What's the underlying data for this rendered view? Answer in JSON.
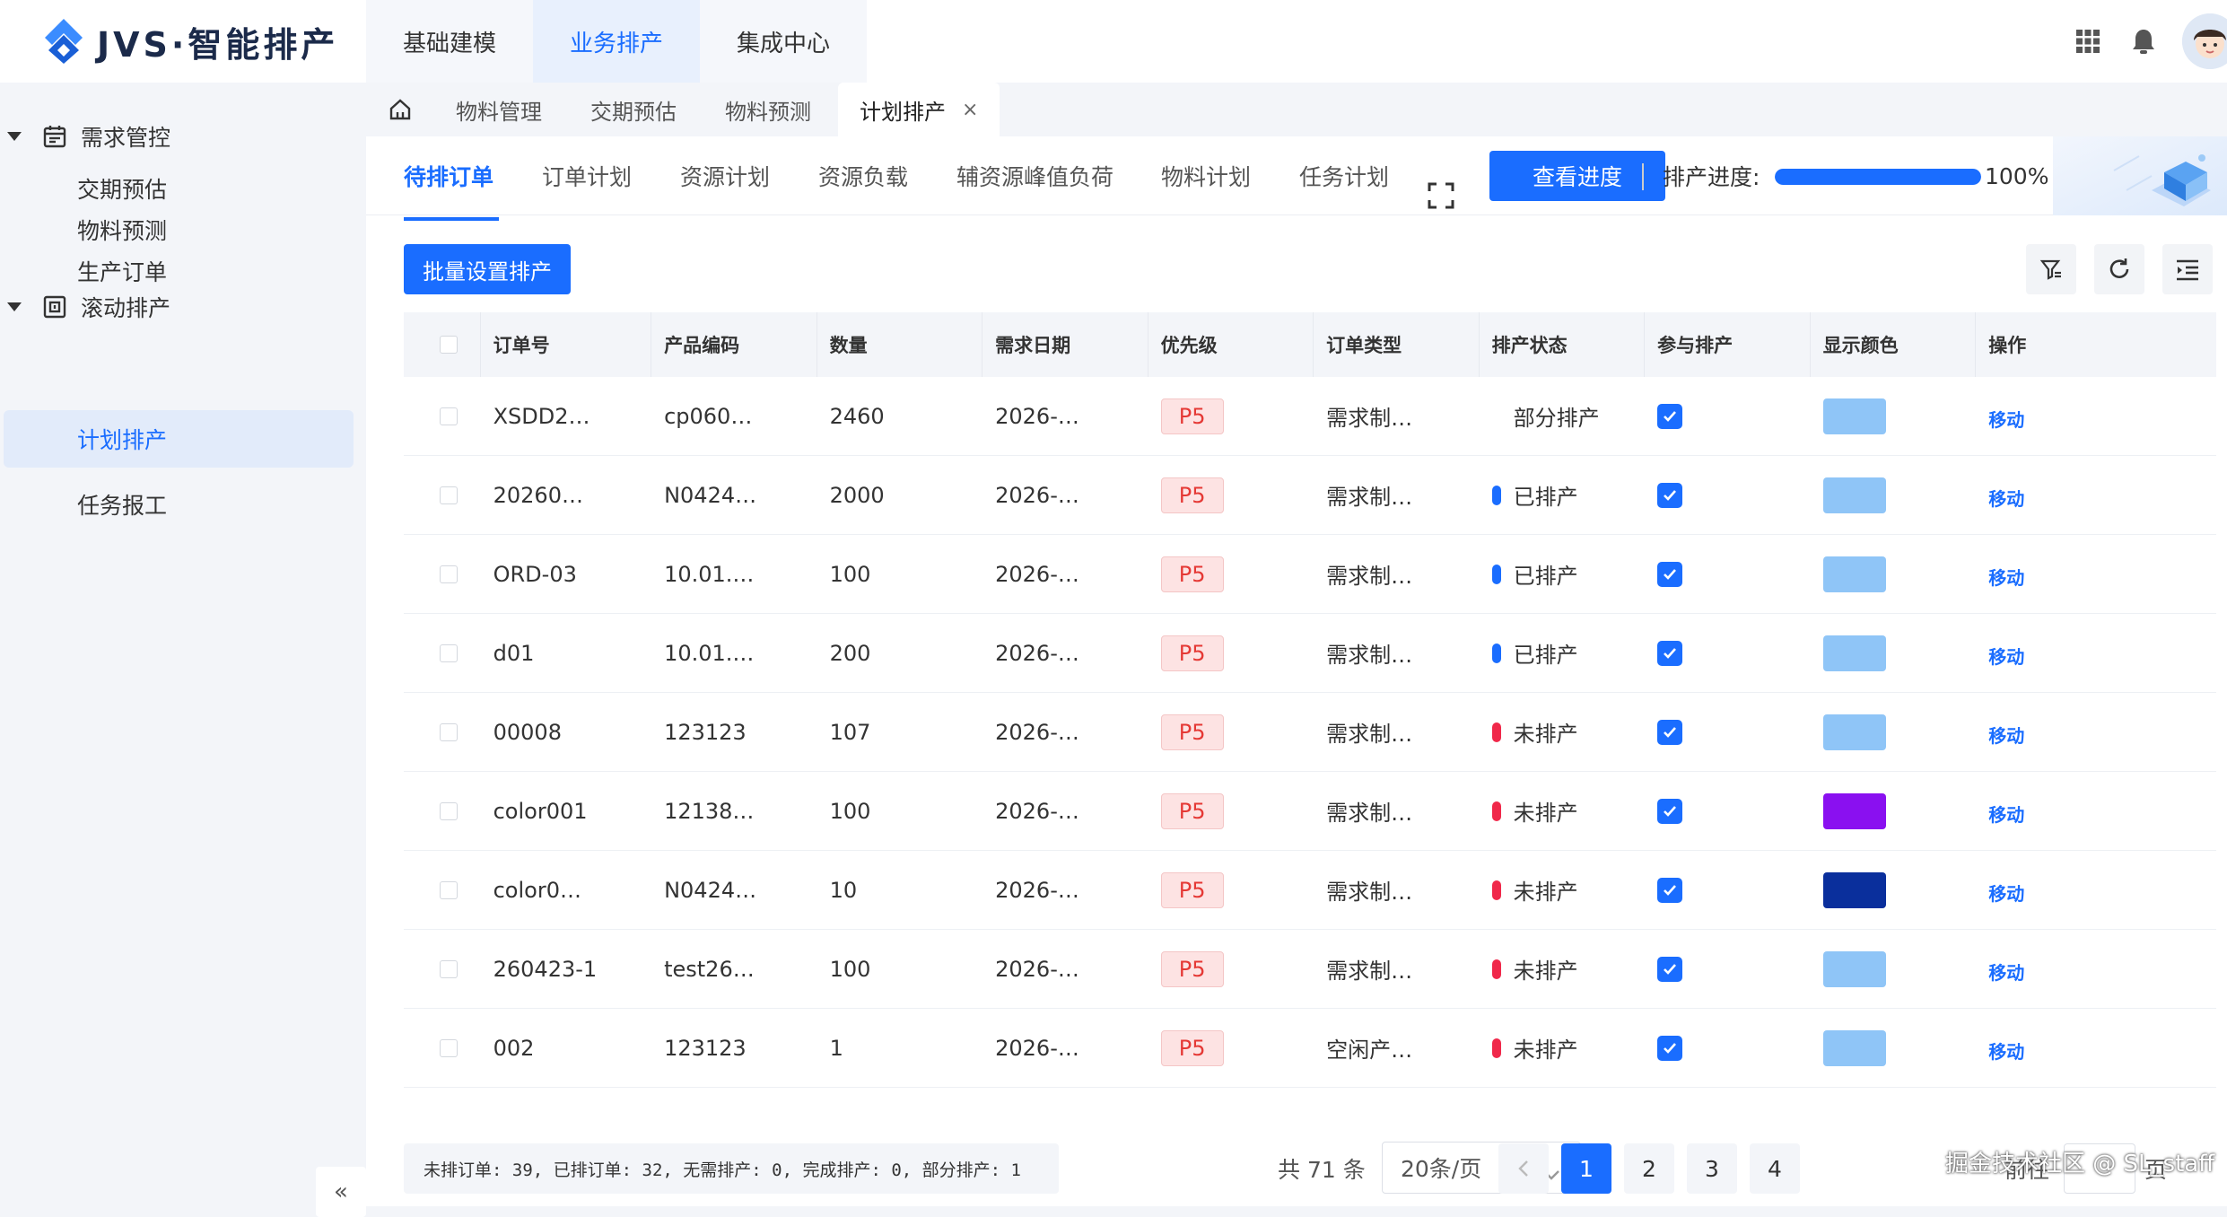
{
  "app": {
    "logo_text": "JVS·智能排产"
  },
  "topnav": [
    "基础建模",
    "业务排产",
    "集成中心"
  ],
  "sidebar": {
    "groups": [
      {
        "label": "需求管控",
        "items": [
          "交期预估",
          "物料预测",
          "生产订单"
        ]
      },
      {
        "label": "滚动排产",
        "items": [
          "计划排产",
          "任务报工"
        ]
      }
    ],
    "collapse_label": "«"
  },
  "page_tabs": [
    "物料管理",
    "交期预估",
    "物料预测",
    "计划排产"
  ],
  "page_tab_close": "×",
  "sub_tabs": [
    "待排订单",
    "订单计划",
    "资源计划",
    "资源负载",
    "辅资源峰值负荷",
    "物料计划",
    "任务计划"
  ],
  "view_progress_button": "查看进度",
  "progress": {
    "label": "排产进度:",
    "percent_text": "100%",
    "value": 1.0
  },
  "batch_button": "批量设置排产",
  "table": {
    "headers": [
      "订单号",
      "产品编码",
      "数量",
      "需求日期",
      "优先级",
      "订单类型",
      "排产状态",
      "参与排产",
      "显示颜色",
      "操作"
    ],
    "rows": [
      {
        "order": "XSDD2…",
        "code": "cp060…",
        "qty": "2460",
        "date": "2026-…",
        "priority": "P5",
        "type": "需求制…",
        "status": "部分排产",
        "status_color": "",
        "swatch": "#8fc5f7",
        "action": "移动"
      },
      {
        "order": "20260…",
        "code": "N0424…",
        "qty": "2000",
        "date": "2026-…",
        "priority": "P5",
        "type": "需求制…",
        "status": "已排产",
        "status_color": "#1a6dff",
        "swatch": "#8fc5f7",
        "action": "移动"
      },
      {
        "order": "ORD-03",
        "code": "10.01.…",
        "qty": "100",
        "date": "2026-…",
        "priority": "P5",
        "type": "需求制…",
        "status": "已排产",
        "status_color": "#1a6dff",
        "swatch": "#8fc5f7",
        "action": "移动"
      },
      {
        "order": "d01",
        "code": "10.01.…",
        "qty": "200",
        "date": "2026-…",
        "priority": "P5",
        "type": "需求制…",
        "status": "已排产",
        "status_color": "#1a6dff",
        "swatch": "#8fc5f7",
        "action": "移动"
      },
      {
        "order": "00008",
        "code": "123123",
        "qty": "107",
        "date": "2026-…",
        "priority": "P5",
        "type": "需求制…",
        "status": "未排产",
        "status_color": "#f0284a",
        "swatch": "#8fc5f7",
        "action": "移动"
      },
      {
        "order": "color001",
        "code": "12138…",
        "qty": "100",
        "date": "2026-…",
        "priority": "P5",
        "type": "需求制…",
        "status": "未排产",
        "status_color": "#f0284a",
        "swatch": "#8a10f0",
        "action": "移动"
      },
      {
        "order": "color0…",
        "code": "N0424…",
        "qty": "10",
        "date": "2026-…",
        "priority": "P5",
        "type": "需求制…",
        "status": "未排产",
        "status_color": "#f0284a",
        "swatch": "#0a2f9c",
        "action": "移动"
      },
      {
        "order": "260423-1",
        "code": "test26…",
        "qty": "100",
        "date": "2026-…",
        "priority": "P5",
        "type": "需求制…",
        "status": "未排产",
        "status_color": "#f0284a",
        "swatch": "#8fc5f7",
        "action": "移动"
      },
      {
        "order": "002",
        "code": "123123",
        "qty": "1",
        "date": "2026-…",
        "priority": "P5",
        "type": "空闲产…",
        "status": "未排产",
        "status_color": "#f0284a",
        "swatch": "#8fc5f7",
        "action": "移动"
      }
    ]
  },
  "footer": {
    "summary": "未排订单: 39, 已排订单: 32, 无需排产: 0, 完成排产: 0, 部分排产: 1",
    "total": "共 71 条",
    "page_size": "20条/页",
    "pages": [
      "1",
      "2",
      "3",
      "4"
    ],
    "goto_label": "前往",
    "goto_unit": "页"
  },
  "watermark": "掘金技术社区 @ SL_staff",
  "colors": {
    "accent": "#1a6dff",
    "danger": "#f0284a"
  }
}
